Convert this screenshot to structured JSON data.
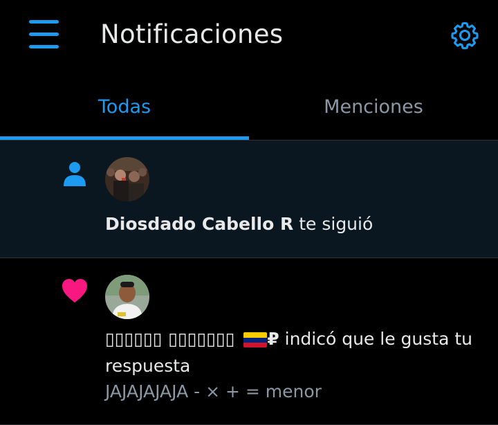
{
  "header": {
    "title": "Notificaciones",
    "menu_icon": "menu-icon",
    "settings_icon": "gear-icon"
  },
  "tabs": [
    {
      "label": "Todas",
      "active": true
    },
    {
      "label": "Menciones",
      "active": false
    }
  ],
  "notifications": [
    {
      "type_icon": "person-icon",
      "user": "Diosdado Cabello R",
      "action": " te siguió"
    },
    {
      "type_icon": "heart-icon",
      "user": "▯▯▯▯▯▯ ▯▯▯▯▯▯▯ ",
      "user_suffix": "₽",
      "action": " indicó que le gusta tu respuesta",
      "preview": "JAJAJAJAJA - × + = menor"
    }
  ],
  "colors": {
    "accent": "#1d9bf0",
    "like": "#f91880",
    "unread_bg": "#0b1720",
    "background": "#000000"
  }
}
